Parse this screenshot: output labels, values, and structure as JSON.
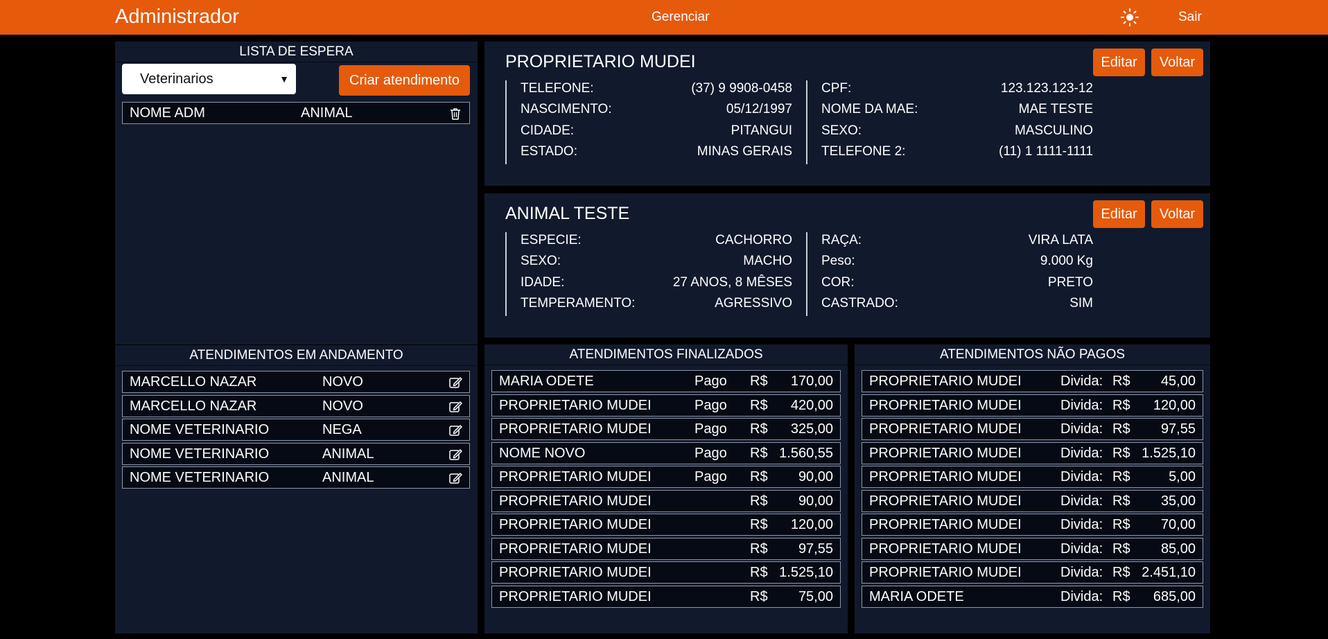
{
  "header": {
    "title": "Administrador",
    "manage_label": "Gerenciar",
    "theme_icon": "sun-icon",
    "exit_label": "Sair"
  },
  "waiting_list": {
    "title": "LISTA DE ESPERA",
    "select_value": "Veterinarios",
    "create_button": "Criar atendimento",
    "items": [
      {
        "name": "NOME ADM",
        "animal": "ANIMAL",
        "icon": "trash-icon"
      }
    ]
  },
  "in_progress": {
    "title": "ATENDIMENTOS EM ANDAMENTO",
    "items": [
      {
        "name": "MARCELLO NAZAR",
        "animal": "NOVO"
      },
      {
        "name": "MARCELLO NAZAR",
        "animal": "NOVO"
      },
      {
        "name": "NOME VETERINARIO",
        "animal": "NEGA"
      },
      {
        "name": "NOME VETERINARIO",
        "animal": "ANIMAL"
      },
      {
        "name": "NOME VETERINARIO",
        "animal": "ANIMAL"
      }
    ],
    "icon": "edit-icon"
  },
  "owner": {
    "name": "PROPRIETARIO MUDEI",
    "edit_label": "Editar",
    "back_label": "Voltar",
    "left": [
      {
        "label": "TELEFONE:",
        "value": "(37) 9 9908-0458"
      },
      {
        "label": "NASCIMENTO:",
        "value": "05/12/1997"
      },
      {
        "label": "CIDADE:",
        "value": "PITANGUI"
      },
      {
        "label": "ESTADO:",
        "value": "MINAS GERAIS"
      }
    ],
    "right": [
      {
        "label": "CPF:",
        "value": "123.123.123-12"
      },
      {
        "label": "NOME DA MAE:",
        "value": "MAE TESTE"
      },
      {
        "label": "SEXO:",
        "value": "MASCULINO"
      },
      {
        "label": "TELEFONE 2:",
        "value": "(11) 1 1111-1111"
      }
    ]
  },
  "animal": {
    "name": "ANIMAL TESTE",
    "edit_label": "Editar",
    "back_label": "Voltar",
    "left": [
      {
        "label": "ESPECIE:",
        "value": "CACHORRO"
      },
      {
        "label": "SEXO:",
        "value": "MACHO"
      },
      {
        "label": "IDADE:",
        "value": "27 ANOS, 8 MÊSES"
      },
      {
        "label": "TEMPERAMENTO:",
        "value": "AGRESSIVO"
      }
    ],
    "right": [
      {
        "label": "RAÇA:",
        "value": "VIRA LATA"
      },
      {
        "label": "Peso:",
        "value": "9.000 Kg"
      },
      {
        "label": "COR:",
        "value": "PRETO"
      },
      {
        "label": "CASTRADO:",
        "value": "SIM"
      }
    ]
  },
  "finished": {
    "title": "ATENDIMENTOS FINALIZADOS",
    "currency": "R$",
    "items": [
      {
        "name": "MARIA ODETE",
        "status": "Pago",
        "amount": "170,00"
      },
      {
        "name": "PROPRIETARIO MUDEI",
        "status": "Pago",
        "amount": "420,00"
      },
      {
        "name": "PROPRIETARIO MUDEI",
        "status": "Pago",
        "amount": "325,00"
      },
      {
        "name": "NOME NOVO",
        "status": "Pago",
        "amount": "1.560,55"
      },
      {
        "name": "PROPRIETARIO MUDEI",
        "status": "Pago",
        "amount": "90,00"
      },
      {
        "name": "PROPRIETARIO MUDEI",
        "status": "",
        "amount": "90,00"
      },
      {
        "name": "PROPRIETARIO MUDEI",
        "status": "",
        "amount": "120,00"
      },
      {
        "name": "PROPRIETARIO MUDEI",
        "status": "",
        "amount": "97,55"
      },
      {
        "name": "PROPRIETARIO MUDEI",
        "status": "",
        "amount": "1.525,10"
      },
      {
        "name": "PROPRIETARIO MUDEI",
        "status": "",
        "amount": "75,00"
      }
    ]
  },
  "unpaid": {
    "title": "ATENDIMENTOS NÃO PAGOS",
    "currency": "R$",
    "debt_label": "Divida:",
    "items": [
      {
        "name": "PROPRIETARIO MUDEI",
        "amount": "45,00"
      },
      {
        "name": "PROPRIETARIO MUDEI",
        "amount": "120,00"
      },
      {
        "name": "PROPRIETARIO MUDEI",
        "amount": "97,55"
      },
      {
        "name": "PROPRIETARIO MUDEI",
        "amount": "1.525,10"
      },
      {
        "name": "PROPRIETARIO MUDEI",
        "amount": "5,00"
      },
      {
        "name": "PROPRIETARIO MUDEI",
        "amount": "35,00"
      },
      {
        "name": "PROPRIETARIO MUDEI",
        "amount": "70,00"
      },
      {
        "name": "PROPRIETARIO MUDEI",
        "amount": "85,00"
      },
      {
        "name": "PROPRIETARIO MUDEI",
        "amount": "2.451,10"
      },
      {
        "name": "MARIA ODETE",
        "amount": "685,00"
      }
    ]
  },
  "colors": {
    "accent": "#e65a0c",
    "panel": "#111a2c",
    "row": "#050a14"
  }
}
